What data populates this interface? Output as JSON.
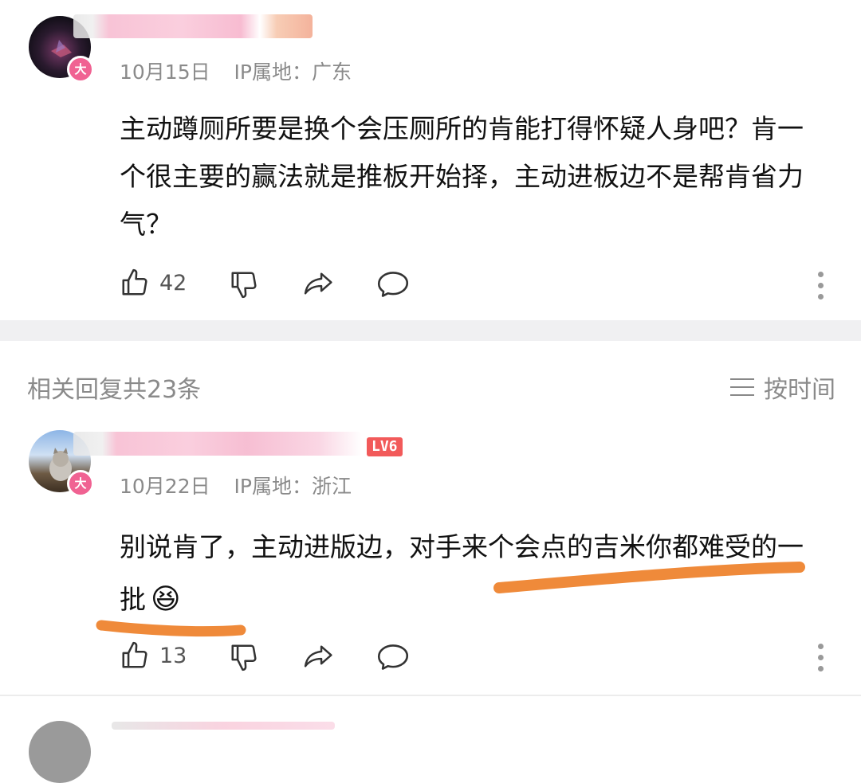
{
  "comment": {
    "date": "10月15日",
    "ip_label": "IP属地：",
    "ip_location": "广东",
    "badge": "大",
    "text": "主动蹲厕所要是换个会压厕所的肯能打得怀疑人身吧？肯一个很主要的赢法就是推板开始择，主动进板边不是帮肯省力气？",
    "likes": "42"
  },
  "replies_header": {
    "title": "相关回复共23条",
    "sort_label": "按时间"
  },
  "reply": {
    "date": "10月22日",
    "ip_label": "IP属地：",
    "ip_location": "浙江",
    "badge": "大",
    "level": "LV6",
    "text": "别说肯了，主动进版边，对手来个会点的吉米你都难受的一批",
    "emoji": "😆",
    "likes": "13"
  },
  "colors": {
    "annotation_orange": "#ef8a3a",
    "badge_pink": "#f06292",
    "level_red": "#f25a5a"
  },
  "icons": [
    "thumb-up-icon",
    "thumb-down-icon",
    "share-icon",
    "comment-icon",
    "more-icon",
    "sort-icon"
  ]
}
